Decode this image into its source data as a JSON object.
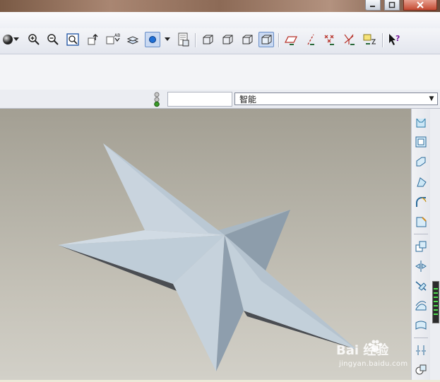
{
  "window": {
    "controls": [
      "minimize-icon",
      "maximize-icon",
      "close-icon"
    ]
  },
  "toolbar": {
    "icons": [
      "shading-sphere-icon",
      "dropdown-arrow-icon",
      "zoom-in-icon",
      "zoom-out-icon",
      "refit-icon",
      "reorient-icon",
      "saved-views-icon",
      "layers-icon",
      "model-display-icon",
      "dropdown-arrow-icon",
      "spin-center-icon",
      "wireframe-icon",
      "hidden-line-icon",
      "no-hidden-icon",
      "shading-icon",
      "datum-planes-icon",
      "datum-axes-icon",
      "datum-points-icon",
      "coordinate-systems-icon",
      "annotations-icon",
      "whats-this-help-icon"
    ]
  },
  "status": {
    "light_color": "#3a9a2a",
    "filter_value": "智能"
  },
  "rightbar": {
    "icons": [
      "extrude-icon",
      "shell-icon",
      "rib-icon",
      "draft-icon",
      "round-icon",
      "chamfer-icon",
      "pattern-icon",
      "mirror-icon",
      "trim-icon",
      "merge-icon",
      "offset-icon",
      "intersect-icon",
      "copy-icon"
    ]
  },
  "viewport": {
    "background_top": "#a39f93",
    "background_bottom": "#d2d0c8",
    "model_color": "#bccbd6"
  },
  "watermark": {
    "brand": "Bai 经验",
    "url": "jingyan.baidu.com"
  }
}
